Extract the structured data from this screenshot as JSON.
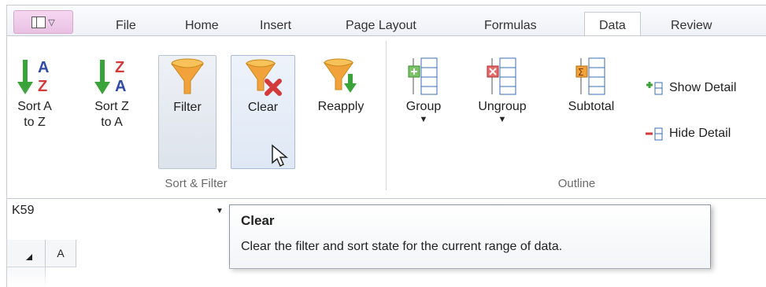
{
  "tabs": [
    "File",
    "Home",
    "Insert",
    "Page Layout",
    "Formulas",
    "Data",
    "Review"
  ],
  "active_tab": "Data",
  "sort_filter": {
    "label": "Sort & Filter",
    "sort_a": [
      "Sort A",
      "to Z"
    ],
    "sort_z": [
      "Sort Z",
      "to A"
    ],
    "filter": "Filter",
    "clear": "Clear",
    "reapply": "Reapply"
  },
  "outline": {
    "label": "Outline",
    "group": "Group",
    "ungroup": "Ungroup",
    "subtotal": "Subtotal",
    "show_detail": "Show Detail",
    "hide_detail": "Hide Detail"
  },
  "name_box": "K59",
  "column_a": "A",
  "tooltip": {
    "title": "Clear",
    "description": "Clear the filter and sort state for the current range of data."
  },
  "colors": {
    "accent": "#c55a9c",
    "green": "#3aa33a",
    "red": "#d33a3a",
    "orange": "#f2a23b"
  }
}
